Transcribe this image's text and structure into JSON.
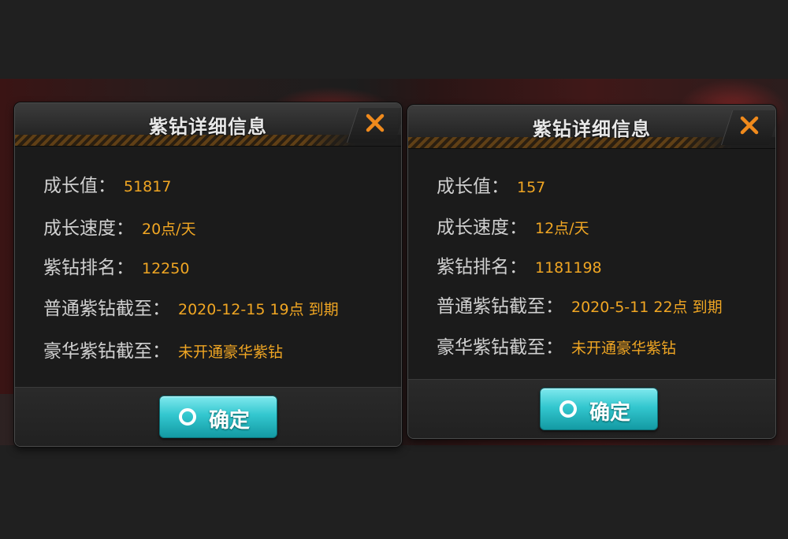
{
  "dialogs": [
    {
      "title": "紫钻详细信息",
      "rows": [
        {
          "label": "成长值：",
          "value": "51817"
        },
        {
          "label": "成长速度：",
          "value": "20点/天"
        },
        {
          "label": "紫钻排名：",
          "value": "12250"
        },
        {
          "label": "普通紫钻截至：",
          "value": "2020-12-15 19点 到期"
        },
        {
          "label": "豪华紫钻截至：",
          "value": "未开通豪华紫钻"
        }
      ],
      "ok_label": "确定"
    },
    {
      "title": "紫钻详细信息",
      "rows": [
        {
          "label": "成长值：",
          "value": "157"
        },
        {
          "label": "成长速度：",
          "value": "12点/天"
        },
        {
          "label": "紫钻排名：",
          "value": "1181198"
        },
        {
          "label": "普通紫钻截至：",
          "value": "2020-5-11 22点 到期"
        },
        {
          "label": "豪华紫钻截至：",
          "value": "未开通豪华紫钻"
        }
      ],
      "ok_label": "确定"
    }
  ],
  "colors": {
    "label": "#d0d0d0",
    "value": "#f0a623",
    "close": "#f08a1c",
    "button": "#33c7cf"
  },
  "icons": {
    "close": "close-icon",
    "ok": "ring-icon"
  }
}
